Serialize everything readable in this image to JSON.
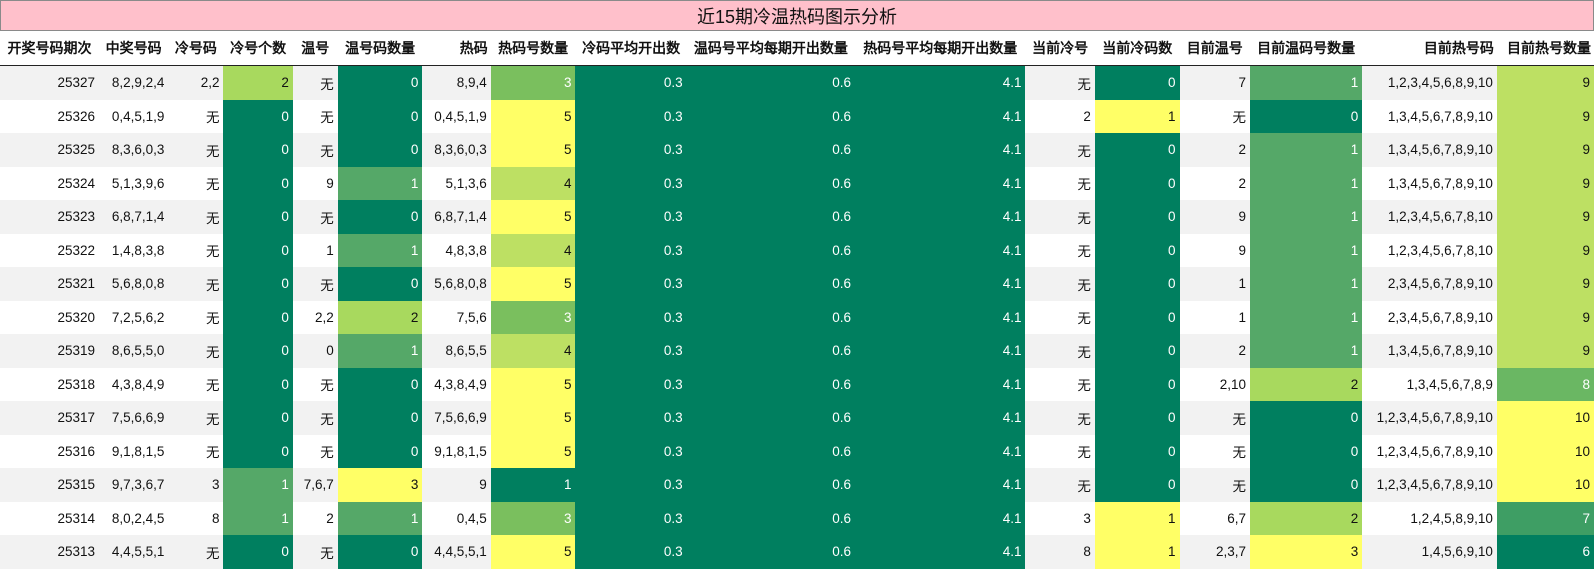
{
  "title": "近15期冷温热码图示分析",
  "headers": [
    "开奖号码期次",
    "中奖号码",
    "冷号码",
    "冷号个数",
    "温号",
    "温号码数量",
    "热码",
    "热码号数量",
    "冷码平均开出数",
    "温码号平均每期开出数量",
    "热码号平均每期开出数量",
    "当前冷号",
    "当前冷码数",
    "目前温号",
    "目前温码号数量",
    "目前热号码",
    "目前热号数量"
  ],
  "colors": {
    "c0": "#007f5f",
    "c1": "#55a868",
    "c2": "#a8d95e",
    "c3": "#ffff66",
    "c4": "#ffff66",
    "c5": "#ffff66",
    "h1": "#007f5f",
    "h3": "#7abf5e",
    "h4": "#bde063",
    "h5": "#ffff66",
    "r6": "#007f5f",
    "r7": "#3e9e64",
    "r8": "#6ab763",
    "r9": "#bde063",
    "r10": "#ffff66",
    "avg": "#007f5f"
  },
  "rows": [
    [
      "25327",
      "8,2,9,2,4",
      "2,2",
      "2",
      "无",
      "0",
      "8,9,4",
      "3",
      "0.3",
      "0.6",
      "4.1",
      "无",
      "0",
      "7",
      "1",
      "1,2,3,4,5,6,8,9,10",
      "9"
    ],
    [
      "25326",
      "0,4,5,1,9",
      "无",
      "0",
      "无",
      "0",
      "0,4,5,1,9",
      "5",
      "0.3",
      "0.6",
      "4.1",
      "2",
      "1",
      "无",
      "0",
      "1,3,4,5,6,7,8,9,10",
      "9"
    ],
    [
      "25325",
      "8,3,6,0,3",
      "无",
      "0",
      "无",
      "0",
      "8,3,6,0,3",
      "5",
      "0.3",
      "0.6",
      "4.1",
      "无",
      "0",
      "2",
      "1",
      "1,3,4,5,6,7,8,9,10",
      "9"
    ],
    [
      "25324",
      "5,1,3,9,6",
      "无",
      "0",
      "9",
      "1",
      "5,1,3,6",
      "4",
      "0.3",
      "0.6",
      "4.1",
      "无",
      "0",
      "2",
      "1",
      "1,3,4,5,6,7,8,9,10",
      "9"
    ],
    [
      "25323",
      "6,8,7,1,4",
      "无",
      "0",
      "无",
      "0",
      "6,8,7,1,4",
      "5",
      "0.3",
      "0.6",
      "4.1",
      "无",
      "0",
      "9",
      "1",
      "1,2,3,4,5,6,7,8,10",
      "9"
    ],
    [
      "25322",
      "1,4,8,3,8",
      "无",
      "0",
      "1",
      "1",
      "4,8,3,8",
      "4",
      "0.3",
      "0.6",
      "4.1",
      "无",
      "0",
      "9",
      "1",
      "1,2,3,4,5,6,7,8,10",
      "9"
    ],
    [
      "25321",
      "5,6,8,0,8",
      "无",
      "0",
      "无",
      "0",
      "5,6,8,0,8",
      "5",
      "0.3",
      "0.6",
      "4.1",
      "无",
      "0",
      "1",
      "1",
      "2,3,4,5,6,7,8,9,10",
      "9"
    ],
    [
      "25320",
      "7,2,5,6,2",
      "无",
      "0",
      "2,2",
      "2",
      "7,5,6",
      "3",
      "0.3",
      "0.6",
      "4.1",
      "无",
      "0",
      "1",
      "1",
      "2,3,4,5,6,7,8,9,10",
      "9"
    ],
    [
      "25319",
      "8,6,5,5,0",
      "无",
      "0",
      "0",
      "1",
      "8,6,5,5",
      "4",
      "0.3",
      "0.6",
      "4.1",
      "无",
      "0",
      "2",
      "1",
      "1,3,4,5,6,7,8,9,10",
      "9"
    ],
    [
      "25318",
      "4,3,8,4,9",
      "无",
      "0",
      "无",
      "0",
      "4,3,8,4,9",
      "5",
      "0.3",
      "0.6",
      "4.1",
      "无",
      "0",
      "2,10",
      "2",
      "1,3,4,5,6,7,8,9",
      "8"
    ],
    [
      "25317",
      "7,5,6,6,9",
      "无",
      "0",
      "无",
      "0",
      "7,5,6,6,9",
      "5",
      "0.3",
      "0.6",
      "4.1",
      "无",
      "0",
      "无",
      "0",
      "1,2,3,4,5,6,7,8,9,10",
      "10"
    ],
    [
      "25316",
      "9,1,8,1,5",
      "无",
      "0",
      "无",
      "0",
      "9,1,8,1,5",
      "5",
      "0.3",
      "0.6",
      "4.1",
      "无",
      "0",
      "无",
      "0",
      "1,2,3,4,5,6,7,8,9,10",
      "10"
    ],
    [
      "25315",
      "9,7,3,6,7",
      "3",
      "1",
      "7,6,7",
      "3",
      "9",
      "1",
      "0.3",
      "0.6",
      "4.1",
      "无",
      "0",
      "无",
      "0",
      "1,2,3,4,5,6,7,8,9,10",
      "10"
    ],
    [
      "25314",
      "8,0,2,4,5",
      "8",
      "1",
      "2",
      "1",
      "0,4,5",
      "3",
      "0.3",
      "0.6",
      "4.1",
      "3",
      "1",
      "6,7",
      "2",
      "1,2,4,5,8,9,10",
      "7"
    ],
    [
      "25313",
      "4,4,5,5,1",
      "无",
      "0",
      "无",
      "0",
      "4,4,5,5,1",
      "5",
      "0.3",
      "0.6",
      "4.1",
      "8",
      "1",
      "2,3,7",
      "3",
      "1,4,5,6,9,10",
      "6"
    ]
  ]
}
